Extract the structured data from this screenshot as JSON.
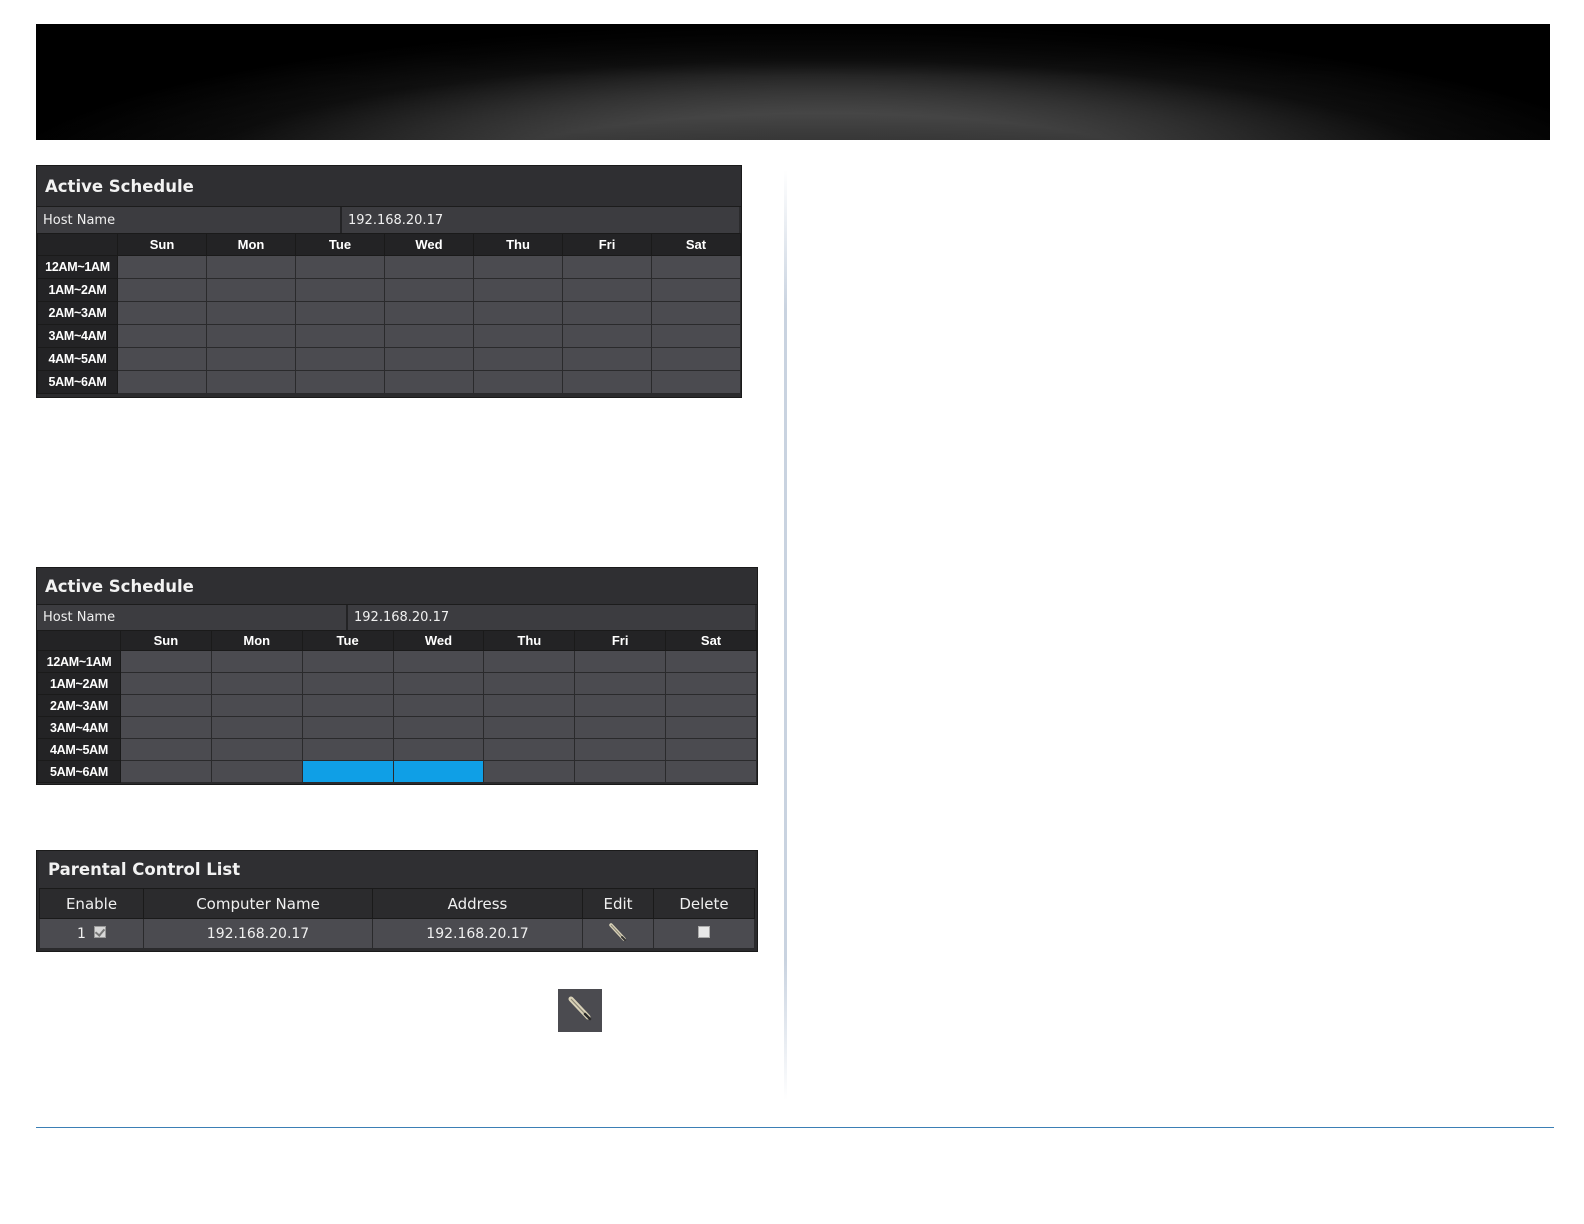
{
  "schedule_top": {
    "title": "Active Schedule",
    "host_label": "Host Name",
    "host_value": "192.168.20.17",
    "days": [
      "Sun",
      "Mon",
      "Tue",
      "Wed",
      "Thu",
      "Fri",
      "Sat"
    ],
    "hours": [
      "12AM~1AM",
      "1AM~2AM",
      "2AM~3AM",
      "3AM~4AM",
      "4AM~5AM",
      "5AM~6AM"
    ],
    "selected_cells": []
  },
  "schedule_bottom": {
    "title": "Active Schedule",
    "host_label": "Host Name",
    "host_value": "192.168.20.17",
    "days": [
      "Sun",
      "Mon",
      "Tue",
      "Wed",
      "Thu",
      "Fri",
      "Sat"
    ],
    "hours": [
      "12AM~1AM",
      "1AM~2AM",
      "2AM~3AM",
      "3AM~4AM",
      "4AM~5AM",
      "5AM~6AM"
    ],
    "selected_cells": [
      {
        "hour": "5AM~6AM",
        "day": "Tue"
      },
      {
        "hour": "5AM~6AM",
        "day": "Wed"
      }
    ],
    "selected_color": "#0f9fe6"
  },
  "parental_list": {
    "title": "Parental Control List",
    "columns": [
      "Enable",
      "Computer Name",
      "Address",
      "Edit",
      "Delete"
    ],
    "rows": [
      {
        "index": "1",
        "enabled": true,
        "computer_name": "192.168.20.17",
        "address": "192.168.20.17",
        "edit_icon": "pencil-icon",
        "delete_checked": false
      }
    ]
  },
  "standalone_edit_icon": "pencil-icon",
  "colors": {
    "accent_line": "#3b7fb5",
    "panel_dark": "#2b2b2d",
    "cell": "#4b4b50"
  }
}
